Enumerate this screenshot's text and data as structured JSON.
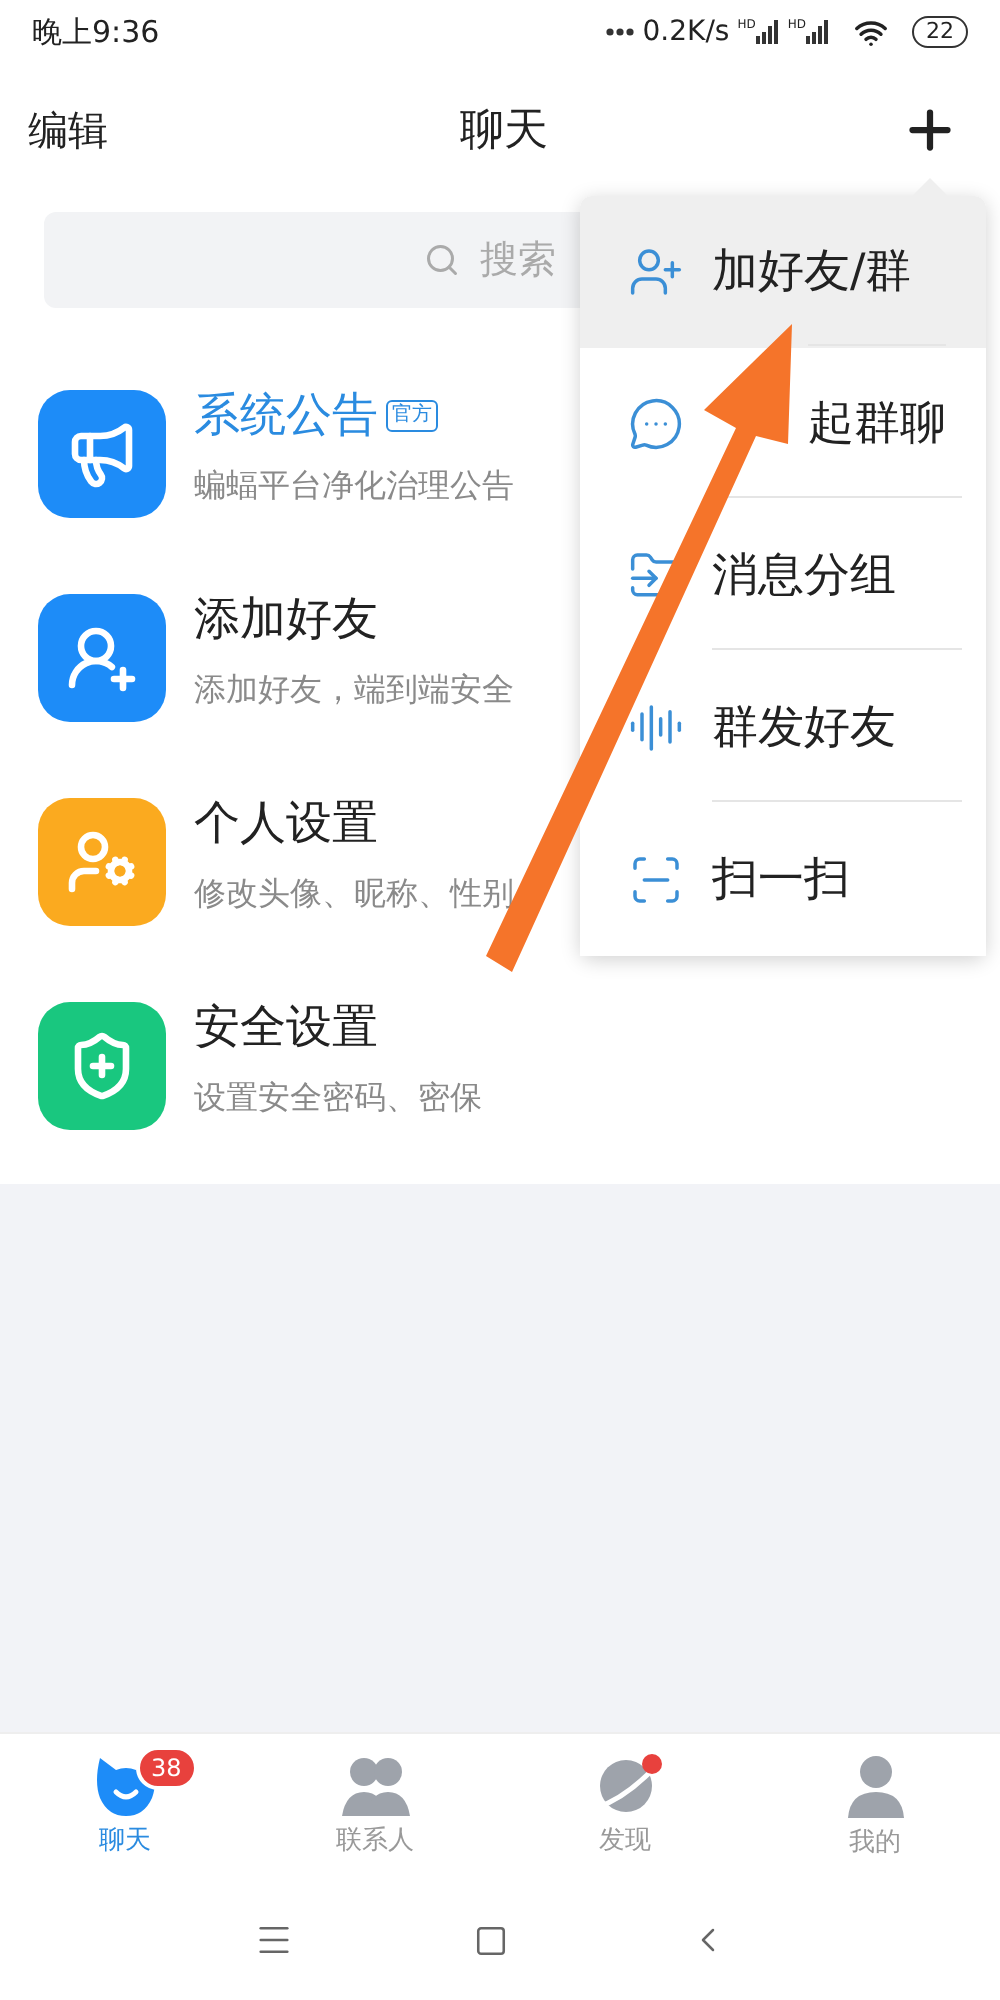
{
  "status_bar": {
    "time": "晚上9:36",
    "speed": "0.2K/s",
    "sims": [
      "HD",
      "HD"
    ],
    "battery": "22"
  },
  "header": {
    "left": "编辑",
    "title": "聊天"
  },
  "search": {
    "placeholder": "搜索"
  },
  "items": [
    {
      "kind": "notice",
      "color": "#1d8cf8",
      "title": "系统公告",
      "badge": "官方",
      "subtitle": "蝙蝠平台净化治理公告"
    },
    {
      "kind": "add",
      "color": "#1d8cf8",
      "title": "添加好友",
      "subtitle": "添加好友，端到端安全"
    },
    {
      "kind": "profile",
      "color": "#fbaa1f",
      "title": "个人设置",
      "subtitle": "修改头像、昵称、性别"
    },
    {
      "kind": "security",
      "color": "#19c77f",
      "title": "安全设置",
      "subtitle": "设置安全密码、密保"
    }
  ],
  "menu": [
    {
      "kind": "add",
      "label": "加好友/群",
      "selected": true
    },
    {
      "kind": "group",
      "label": "起群聊",
      "selected": false
    },
    {
      "kind": "folder",
      "label": "消息分组",
      "selected": false
    },
    {
      "kind": "broadcast",
      "label": "群发好友",
      "selected": false
    },
    {
      "kind": "scan",
      "label": "扫一扫",
      "selected": false
    }
  ],
  "tabs": [
    {
      "kind": "chat",
      "label": "聊天",
      "selected": true,
      "badge": "38",
      "dot": false
    },
    {
      "kind": "contacts",
      "label": "联系人",
      "selected": false,
      "dot": false
    },
    {
      "kind": "discover",
      "label": "发现",
      "selected": false,
      "dot": true
    },
    {
      "kind": "me",
      "label": "我的",
      "selected": false,
      "dot": false
    }
  ]
}
